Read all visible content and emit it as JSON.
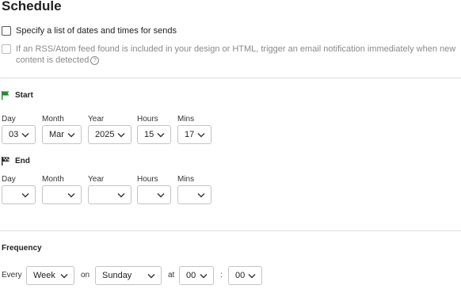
{
  "schedule": {
    "title": "Schedule",
    "specify_list_label": "Specify a list of dates and times for sends",
    "rss_label": "If an RSS/Atom feed found is included in your design or HTML, trigger an email notification immediately when new content is detected",
    "help_glyph": "?"
  },
  "start": {
    "heading": "Start",
    "labels": {
      "day": "Day",
      "month": "Month",
      "year": "Year",
      "hours": "Hours",
      "mins": "Mins"
    },
    "values": {
      "day": "03",
      "month": "Mar",
      "year": "2025",
      "hours": "15",
      "mins": "17"
    }
  },
  "end": {
    "heading": "End",
    "labels": {
      "day": "Day",
      "month": "Month",
      "year": "Year",
      "hours": "Hours",
      "mins": "Mins"
    },
    "values": {
      "day": "",
      "month": "",
      "year": "",
      "hours": "",
      "mins": ""
    }
  },
  "frequency": {
    "heading": "Frequency",
    "every_label": "Every",
    "period": "Week",
    "on_label": "on",
    "weekday": "Sunday",
    "at_label": "at",
    "hour": "00",
    "separator": ":",
    "minute": "00"
  },
  "colors": {
    "start_flag": "#1e8a2e",
    "end_flag": "#222222",
    "border": "#c4c4c4",
    "divider": "#dcdcdc"
  },
  "icons": {
    "start": "flag-icon",
    "end": "checkered-flag-icon",
    "help": "help-circle-icon",
    "dropdown": "chevron-down-icon"
  }
}
